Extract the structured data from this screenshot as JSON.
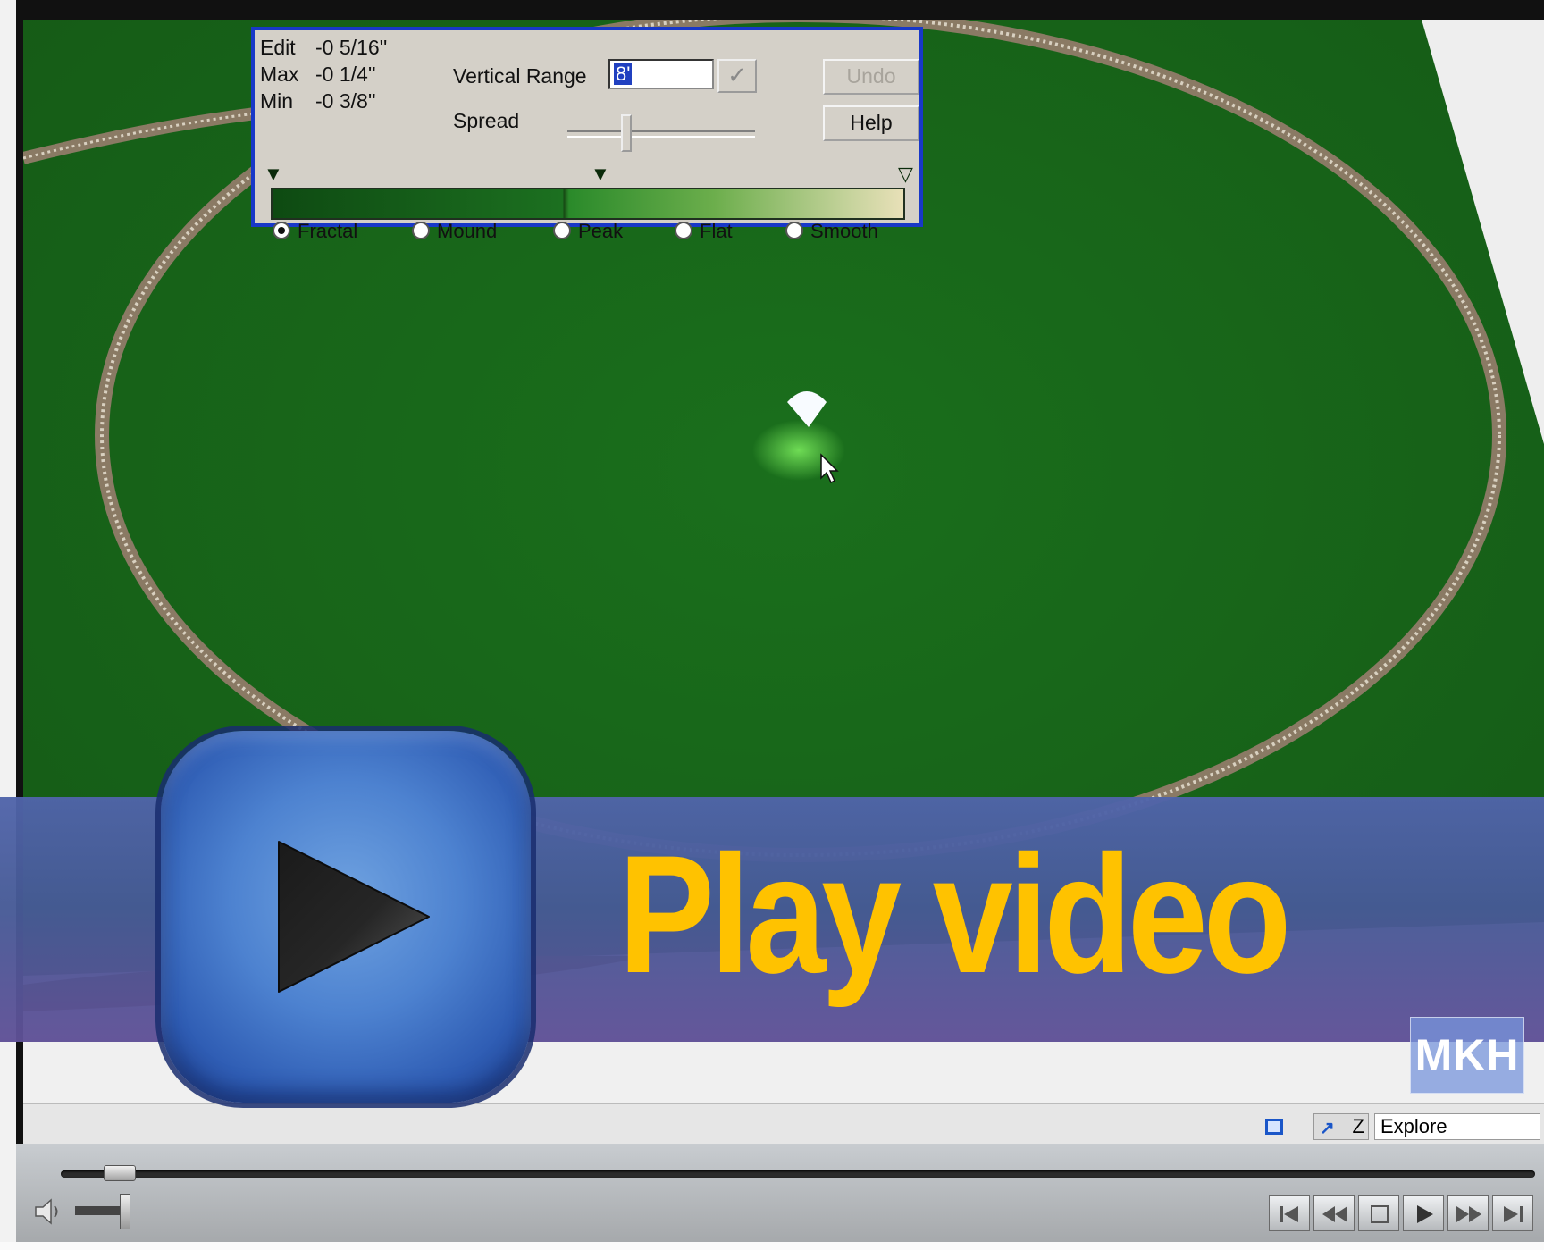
{
  "tool_panel": {
    "edit_label": "Edit",
    "edit_value": "-0 5/16''",
    "max_label": "Max",
    "max_value": "-0 1/4''",
    "min_label": "Min",
    "min_value": "-0 3/8''",
    "vertical_range_label": "Vertical Range",
    "vertical_range_value": "8'",
    "spread_label": "Spread",
    "undo_label": "Undo",
    "help_label": "Help",
    "brush_modes": [
      "Fractal",
      "Mound",
      "Peak",
      "Flat",
      "Smooth"
    ],
    "selected_mode": "Fractal"
  },
  "status_strip": {
    "axis_label": "Z",
    "mode_value": "Explore"
  },
  "overlay": {
    "play_text": "Play video",
    "watermark": "MKH",
    "text_color": "#ffc200",
    "banner_color": "#4f64a6"
  },
  "icons": [
    "play-icon",
    "volume-icon",
    "skip-back-icon",
    "rewind-icon",
    "stop-icon",
    "play-small-icon",
    "fast-forward-icon",
    "skip-forward-icon",
    "view-icon",
    "axis-icon"
  ]
}
